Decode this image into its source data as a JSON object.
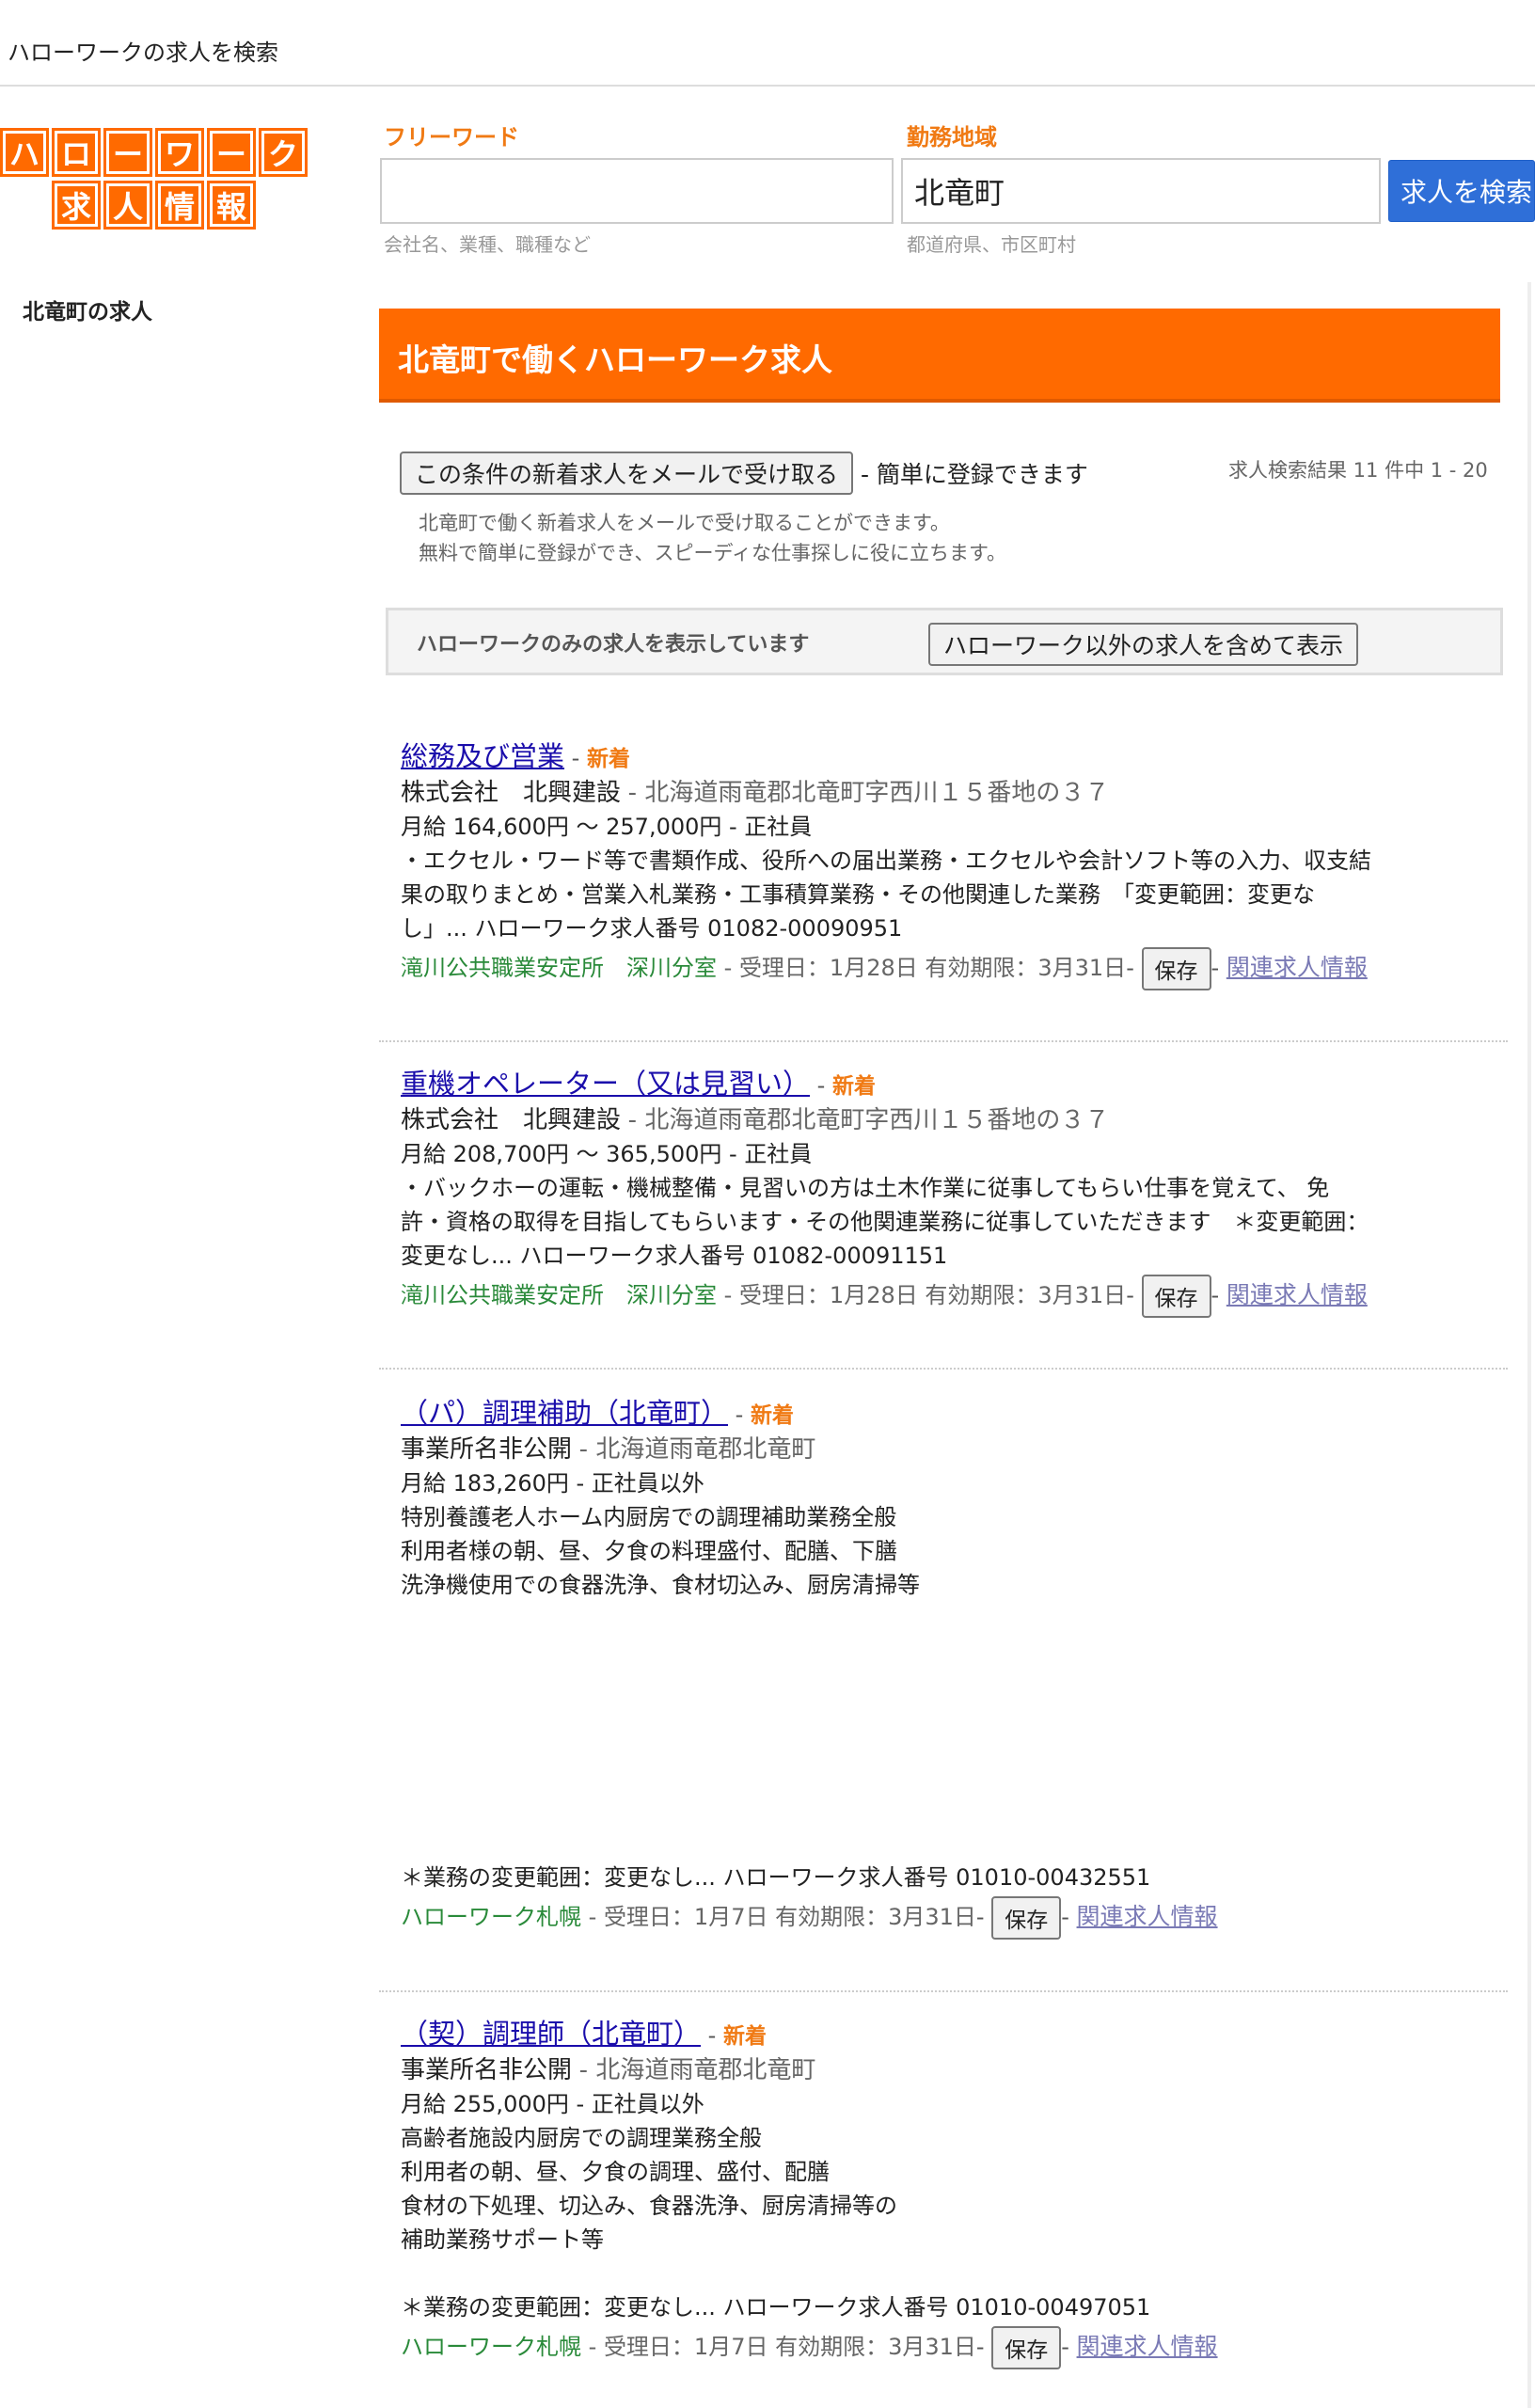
{
  "page_title": "ハローワークの求人を検索",
  "logo": {
    "row1": [
      "ハ",
      "ロ",
      "ー",
      "ワ",
      "ー",
      "ク"
    ],
    "row2": [
      "求",
      "人",
      "情",
      "報"
    ]
  },
  "search": {
    "keyword_label": "フリーワード",
    "keyword_value": "",
    "keyword_hint": "会社名、業種、職種など",
    "area_label": "勤務地域",
    "area_value": "北竜町",
    "area_hint": "都道府県、市区町村",
    "button": "求人を検索"
  },
  "sidebar": {
    "title": "北竜町の求人"
  },
  "banner": {
    "title": "北竜町で働くハローワーク求人"
  },
  "alert": {
    "button": "この条件の新着求人をメールで受け取る",
    "suffix": "- 簡単に登録できます",
    "desc1": "北竜町で働く新着求人をメールで受け取ることができます。",
    "desc2": "無料で簡単に登録ができ、スピーディな仕事探しに役に立ちます。",
    "count": "求人検索結果 11 件中 1 - 20"
  },
  "filter": {
    "text": "ハローワークのみの求人を表示しています",
    "button": "ハローワーク以外の求人を含めて表示"
  },
  "jobs": [
    {
      "title": "総務及び営業",
      "new": "新着",
      "company": "株式会社　北興建設",
      "address": "北海道雨竜郡北竜町字西川１５番地の３７",
      "salary": "月給 164,600円 〜 257,000円",
      "type": "正社員",
      "desc": [
        "・エクセル・ワード等で書類作成、役所への届出業務・エクセルや会計ソフト等の入力、収支結",
        "果の取りまとめ・営業入札業務・工事積算業務・その他関連した業務　「変更範囲：変更な",
        "し」... ハローワーク求人番号 01082-00090951"
      ],
      "office": "滝川公共職業安定所　深川分室",
      "dates": "受理日：1月28日  有効期限：3月31日",
      "save": "保存",
      "related": "関連求人情報"
    },
    {
      "title": "重機オペレーター（又は見習い）",
      "new": "新着",
      "company": "株式会社　北興建設",
      "address": "北海道雨竜郡北竜町字西川１５番地の３７",
      "salary": "月給 208,700円 〜 365,500円",
      "type": "正社員",
      "desc": [
        "・バックホーの運転・機械整備・見習いの方は土木作業に従事してもらい仕事を覚えて、 免",
        "許・資格の取得を目指してもらいます・その他関連業務に従事していただきます　＊変更範囲：",
        "変更なし... ハローワーク求人番号 01082-00091151"
      ],
      "office": "滝川公共職業安定所　深川分室",
      "dates": "受理日：1月28日  有効期限：3月31日",
      "save": "保存",
      "related": "関連求人情報"
    },
    {
      "title": "（パ）調理補助（北竜町）",
      "new": "新着",
      "company": "事業所名非公開",
      "address": "北海道雨竜郡北竜町",
      "salary": "月給 183,260円",
      "type": "正社員以外",
      "desc": [
        "特別養護老人ホーム内厨房での調理補助業務全般",
        "利用者様の朝、昼、夕食の料理盛付、配膳、下膳",
        "洗浄機使用での食器洗浄、食材切込み、厨房清掃等"
      ],
      "desc_tail": "＊業務の変更範囲：変更なし... ハローワーク求人番号 01010-00432551",
      "office": "ハローワーク札幌",
      "dates": "受理日：1月7日  有効期限：3月31日",
      "save": "保存",
      "related": "関連求人情報"
    },
    {
      "title": "（契）調理師（北竜町）",
      "new": "新着",
      "company": "事業所名非公開",
      "address": "北海道雨竜郡北竜町",
      "salary": "月給 255,000円",
      "type": "正社員以外",
      "desc": [
        "高齢者施設内厨房での調理業務全般",
        "利用者の朝、昼、夕食の調理、盛付、配膳",
        "食材の下処理、切込み、食器洗浄、厨房清掃等の",
        "補助業務サポート等"
      ],
      "desc_tail": "＊業務の変更範囲：変更なし... ハローワーク求人番号 01010-00497051",
      "office": "ハローワーク札幌",
      "dates": "受理日：1月7日  有効期限：3月31日",
      "save": "保存",
      "related": "関連求人情報"
    }
  ]
}
